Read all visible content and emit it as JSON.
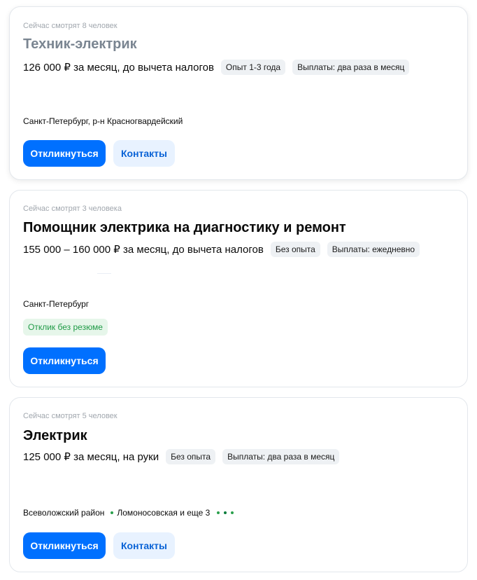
{
  "vacancies": [
    {
      "viewers": "Сейчас смотрят 8 человек",
      "title": "Техник-электрик",
      "salary": "126 000 ₽ за месяц, до вычета налогов",
      "chips": [
        "Опыт 1-3 года",
        "Выплаты: два раза в месяц"
      ],
      "location": "Санкт-Петербург, р-н Красногвардейский",
      "respond_label": "Откликнуться",
      "contacts_label": "Контакты"
    },
    {
      "viewers": "Сейчас смотрят 3 человека",
      "title": "Помощник электрика на диагностику и ремонт",
      "salary": "155 000 – 160 000 ₽ за месяц, до вычета налогов",
      "chips": [
        "Без опыта",
        "Выплаты: ежедневно"
      ],
      "location": "Санкт-Петербург",
      "badge": "Отклик без резюме",
      "respond_label": "Откликнуться"
    },
    {
      "viewers": "Сейчас смотрят 5 человек",
      "title": "Электрик",
      "salary": "125 000 ₽ за месяц, на руки",
      "chips": [
        "Без опыта",
        "Выплаты: два раза в месяц"
      ],
      "location": "Всеволожский район",
      "metro": "Ломоносовская и еще 3",
      "metro_dot_colors": [
        "#2aa04c",
        "#0a7d3c",
        "#2aa04c"
      ],
      "respond_label": "Откликнуться",
      "contacts_label": "Контакты"
    }
  ],
  "colors": {
    "primary": "#0070ff",
    "secondary_bg": "#e8f2ff",
    "metro_green": "#2aa04c",
    "badge_green": "#1f9a46"
  }
}
